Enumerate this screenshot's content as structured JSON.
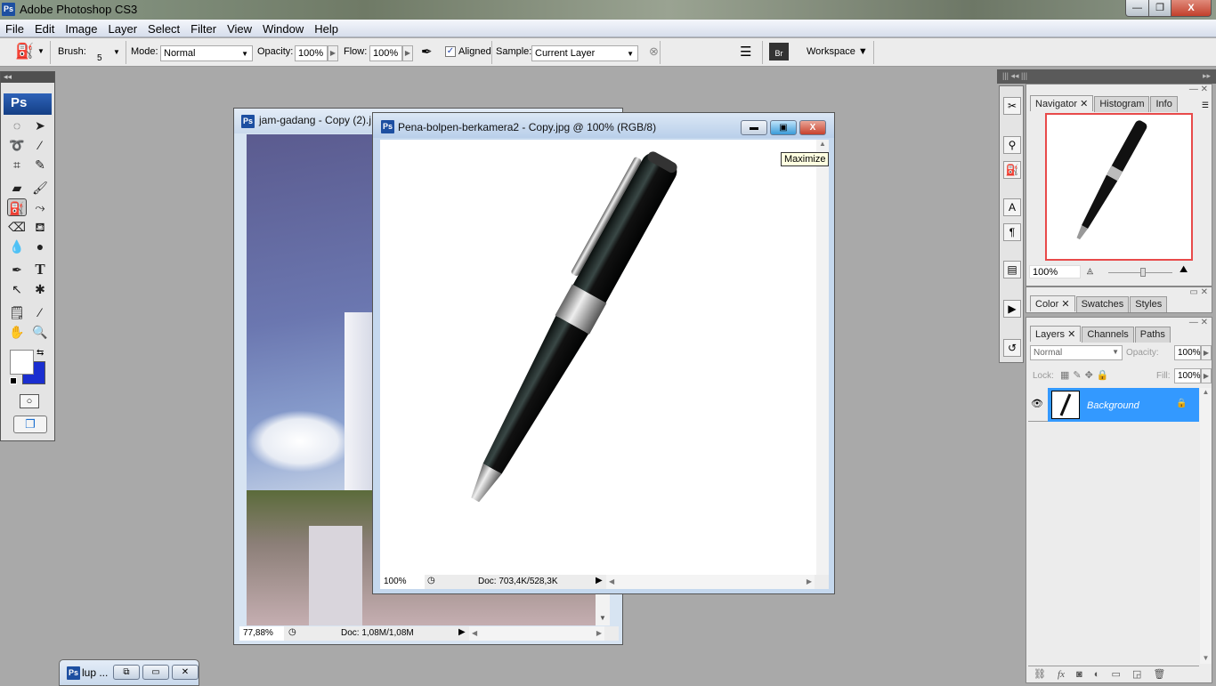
{
  "app": {
    "title": "Adobe Photoshop CS3",
    "logo": "Ps"
  },
  "menu": [
    "File",
    "Edit",
    "Image",
    "Layer",
    "Select",
    "Filter",
    "View",
    "Window",
    "Help"
  ],
  "options": {
    "brush_label": "Brush:",
    "brush_size": "5",
    "mode_label": "Mode:",
    "mode_value": "Normal",
    "opacity_label": "Opacity:",
    "opacity_value": "100%",
    "flow_label": "Flow:",
    "flow_value": "100%",
    "aligned_label": "Aligned",
    "aligned_checked": true,
    "sample_label": "Sample:",
    "sample_value": "Current Layer",
    "workspace_label": "Workspace"
  },
  "toolbox": {
    "logo": "Ps",
    "foreground_color": "#ffffff",
    "background_color": "#1a2ed0"
  },
  "documents": [
    {
      "title": "jam-gadang - Copy (2).j",
      "zoom": "77,88%",
      "doc_info": "Doc: 1,08M/1,08M"
    },
    {
      "title": "Pena-bolpen-berkamera2 - Copy.jpg @ 100% (RGB/8)",
      "zoom": "100%",
      "doc_info": "Doc: 703,4K/528,3K"
    }
  ],
  "tooltip": "Maximize",
  "minimized": {
    "title": "lup ..."
  },
  "navigator": {
    "tabs": [
      "Navigator",
      "Histogram",
      "Info"
    ],
    "zoom": "100%",
    "view_box_color": "#e84a4a"
  },
  "color_panel": {
    "tabs": [
      "Color",
      "Swatches",
      "Styles"
    ]
  },
  "layers_panel": {
    "tabs": [
      "Layers",
      "Channels",
      "Paths"
    ],
    "blend_mode": "Normal",
    "opacity_label": "Opacity:",
    "opacity_value": "100%",
    "lock_label": "Lock:",
    "fill_label": "Fill:",
    "fill_value": "100%",
    "layers": [
      {
        "name": "Background",
        "selected": true,
        "locked": true,
        "visible": true
      }
    ],
    "selected_color": "#3399ff"
  }
}
